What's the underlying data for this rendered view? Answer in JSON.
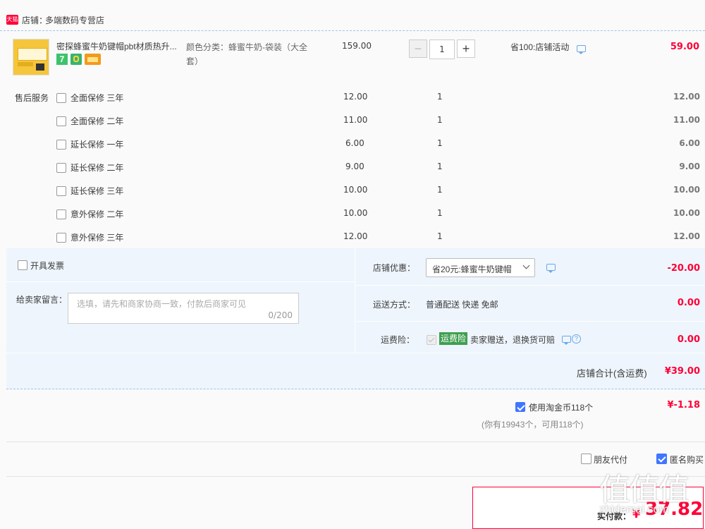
{
  "shop": {
    "badge": "天猫",
    "label": "店铺：",
    "name": "多端数码专营店"
  },
  "item": {
    "title": "密探蜂蜜牛奶键帽pbt材质热升...",
    "spec": "颜色分类：蜂蜜牛奶-袋装（大全套）",
    "price": "159.00",
    "qty": "1",
    "minus": "−",
    "plus": "+",
    "promo": "省100:店铺活动",
    "subtotal": "59.00",
    "badges": {
      "seven": "7"
    }
  },
  "service": {
    "label": "售后服务",
    "options": [
      {
        "name": "全面保修 三年",
        "price": "12.00",
        "qty": "1",
        "total": "12.00"
      },
      {
        "name": "全面保修 二年",
        "price": "11.00",
        "qty": "1",
        "total": "11.00"
      },
      {
        "name": "延长保修 一年",
        "price": "6.00",
        "qty": "1",
        "total": "6.00"
      },
      {
        "name": "延长保修 二年",
        "price": "9.00",
        "qty": "1",
        "total": "9.00"
      },
      {
        "name": "延长保修 三年",
        "price": "10.00",
        "qty": "1",
        "total": "10.00"
      },
      {
        "name": "意外保修 二年",
        "price": "10.00",
        "qty": "1",
        "total": "10.00"
      },
      {
        "name": "意外保修 三年",
        "price": "12.00",
        "qty": "1",
        "total": "12.00"
      }
    ]
  },
  "invoice": {
    "label": "开具发票"
  },
  "message": {
    "label": "给卖家留言：",
    "placeholder": "选填，请先和商家协商一致，付款后商家可见",
    "counter": "0/200"
  },
  "coupon": {
    "label": "店铺优惠：",
    "selected": "省20元:蜂蜜牛奶键帽",
    "amount": "-20.00"
  },
  "shipping": {
    "label": "运送方式：",
    "value": "普通配送 快递 免邮",
    "amount": "0.00"
  },
  "insurance": {
    "label": "运费险：",
    "tag": "运费险",
    "desc": "卖家赠送，退换货可赔",
    "help": "?",
    "amount": "0.00"
  },
  "store_total": {
    "label": "店铺合计(含运费)",
    "value": "¥39.00"
  },
  "coins": {
    "label": "使用淘金币118个",
    "value": "¥-1.18",
    "note": "(你有19943个，可用118个)"
  },
  "options": {
    "friend_pay": "朋友代付",
    "anonymous": "匿名购买"
  },
  "pay": {
    "label": "实付款：",
    "currency": "¥",
    "amount": "37.82"
  },
  "watermark": {
    "text": "值值值",
    "sub": "zhidemai.com"
  },
  "colors": {
    "accent_red": "#ff0036",
    "blue": "#3f76ff",
    "light_blue_bg": "#eef5fd",
    "green_tag": "#3f9f4f"
  }
}
